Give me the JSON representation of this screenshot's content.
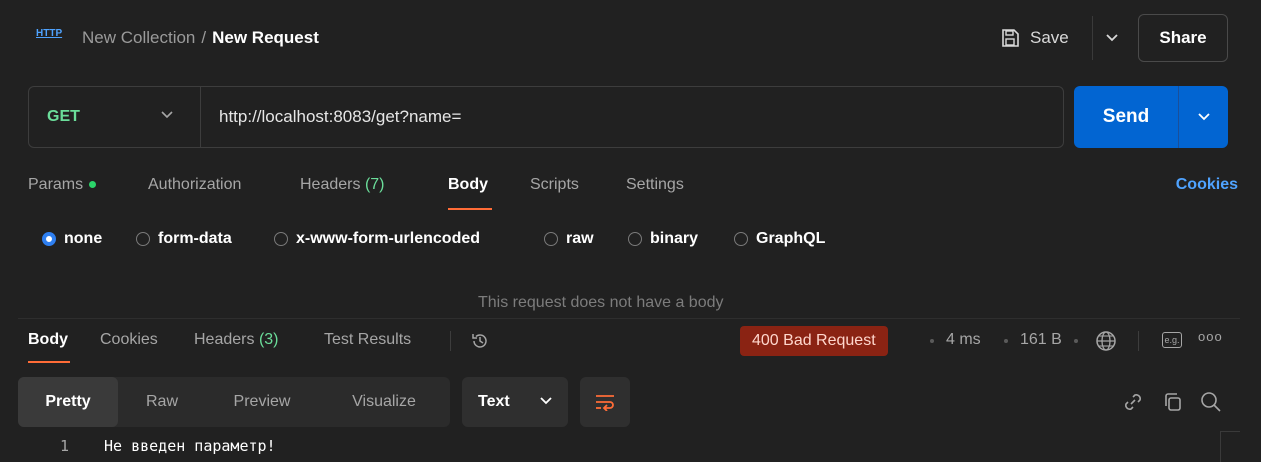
{
  "header": {
    "icon": "http-icon",
    "icon_text": "HTTP",
    "collection": "New Collection",
    "separator": "/",
    "request_name": "New Request",
    "save_label": "Save",
    "share_label": "Share"
  },
  "request": {
    "method": "GET",
    "url": "http://localhost:8083/get?name=",
    "send_label": "Send"
  },
  "request_tabs": {
    "params": "Params",
    "authorization": "Authorization",
    "headers": "Headers",
    "headers_count": "(7)",
    "body": "Body",
    "scripts": "Scripts",
    "settings": "Settings",
    "cookies": "Cookies"
  },
  "body_types": {
    "none": "none",
    "form_data": "form-data",
    "urlencoded": "x-www-form-urlencoded",
    "raw": "raw",
    "binary": "binary",
    "graphql": "GraphQL",
    "selected": "none"
  },
  "no_body_message": "This request does not have a body",
  "response": {
    "tabs": {
      "body": "Body",
      "cookies": "Cookies",
      "headers": "Headers",
      "headers_count": "(3)",
      "test_results": "Test Results"
    },
    "status": "400 Bad Request",
    "time": "4 ms",
    "size": "161 B",
    "example_label": "e.g.",
    "more": "ooo",
    "format_tabs": {
      "pretty": "Pretty",
      "raw": "Raw",
      "preview": "Preview",
      "visualize": "Visualize"
    },
    "language": "Text",
    "lines": [
      {
        "number": "1",
        "text": "Не введен параметр!"
      }
    ]
  },
  "colors": {
    "background": "#212121",
    "accent": "#ff6c37",
    "send": "#0265d2",
    "method": "#6bdd9a",
    "link": "#4fa3ff",
    "status_bg": "#8a2313"
  }
}
